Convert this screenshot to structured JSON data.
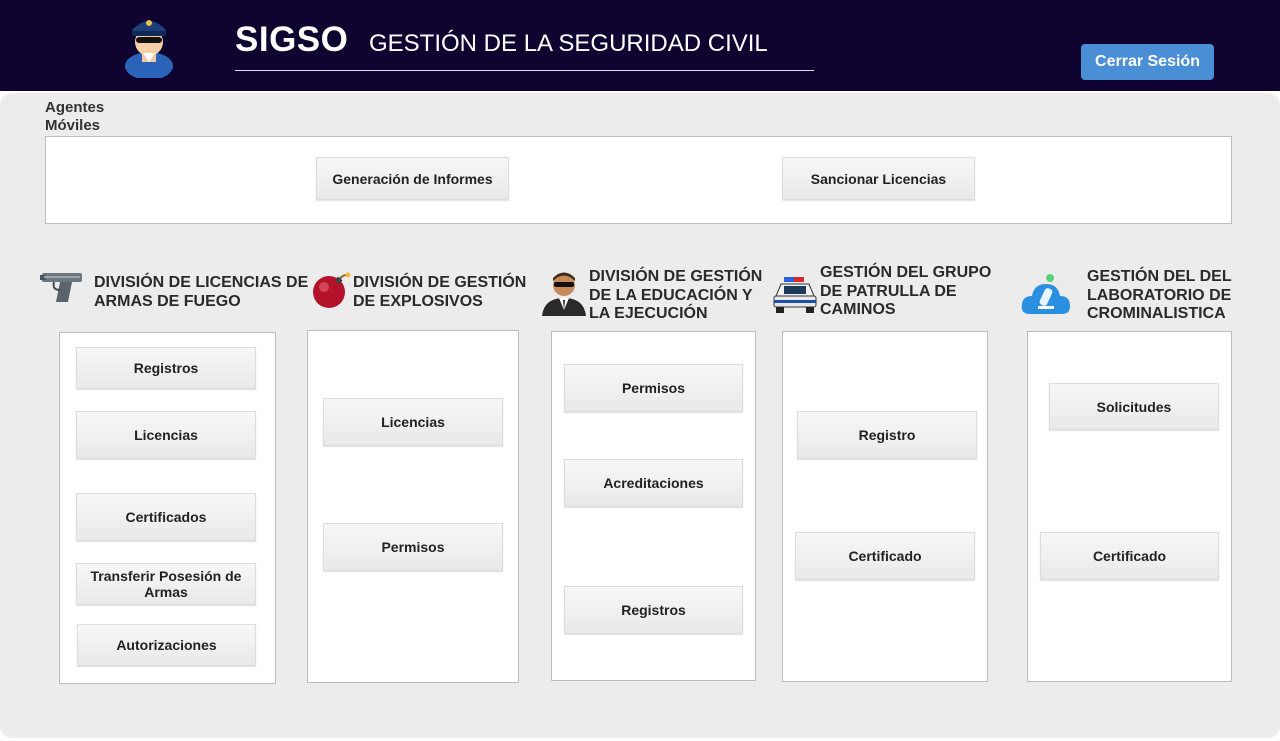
{
  "header": {
    "title": "SIGSO",
    "subtitle": "GESTIÓN DE LA SEGURIDAD CIVIL",
    "logout_label": "Cerrar Sesión",
    "logo_icon": "police-officer-icon"
  },
  "mobile_agents": {
    "label_line1": "Agentes",
    "label_line2": "Móviles",
    "buttons": [
      "Generación de Informes",
      "Sancionar Licencias"
    ]
  },
  "divisions": [
    {
      "title_lines": [
        "DIVISIÓN DE LICENCIAS DE",
        "ARMAS DE FUEGO"
      ],
      "icon": "pistol-icon",
      "buttons": [
        "Registros",
        "Licencias",
        "Certificados",
        "Transferir Posesión de Armas",
        "Autorizaciones"
      ]
    },
    {
      "title_lines": [
        "DIVISIÓN DE GESTIÓN",
        "DE EXPLOSIVOS"
      ],
      "icon": "bomb-icon",
      "buttons": [
        "Licencias",
        "Permisos"
      ]
    },
    {
      "title_lines": [
        "DIVISIÓN DE GESTIÓN",
        "DE LA EDUCACIÓN Y",
        "LA EJECUCIÓN"
      ],
      "icon": "security-agent-icon",
      "buttons": [
        "Permisos",
        "Acreditaciones",
        "Registros"
      ]
    },
    {
      "title_lines": [
        "GESTIÓN DEL GRUPO",
        "DE PATRULLA DE",
        "CAMINOS"
      ],
      "icon": "patrol-car-icon",
      "buttons": [
        "Registro",
        "Certificado"
      ]
    },
    {
      "title_lines": [
        "GESTIÓN DEL DEL",
        "LABORATORIO DE",
        "CROMINALISTICA"
      ],
      "icon": "lab-cloud-icon",
      "buttons": [
        "Solicitudes",
        "Certificado"
      ]
    }
  ],
  "colors": {
    "header_bg": "#0f0330",
    "accent_button": "#4a8fd6",
    "panel_bg": "#ececec"
  }
}
